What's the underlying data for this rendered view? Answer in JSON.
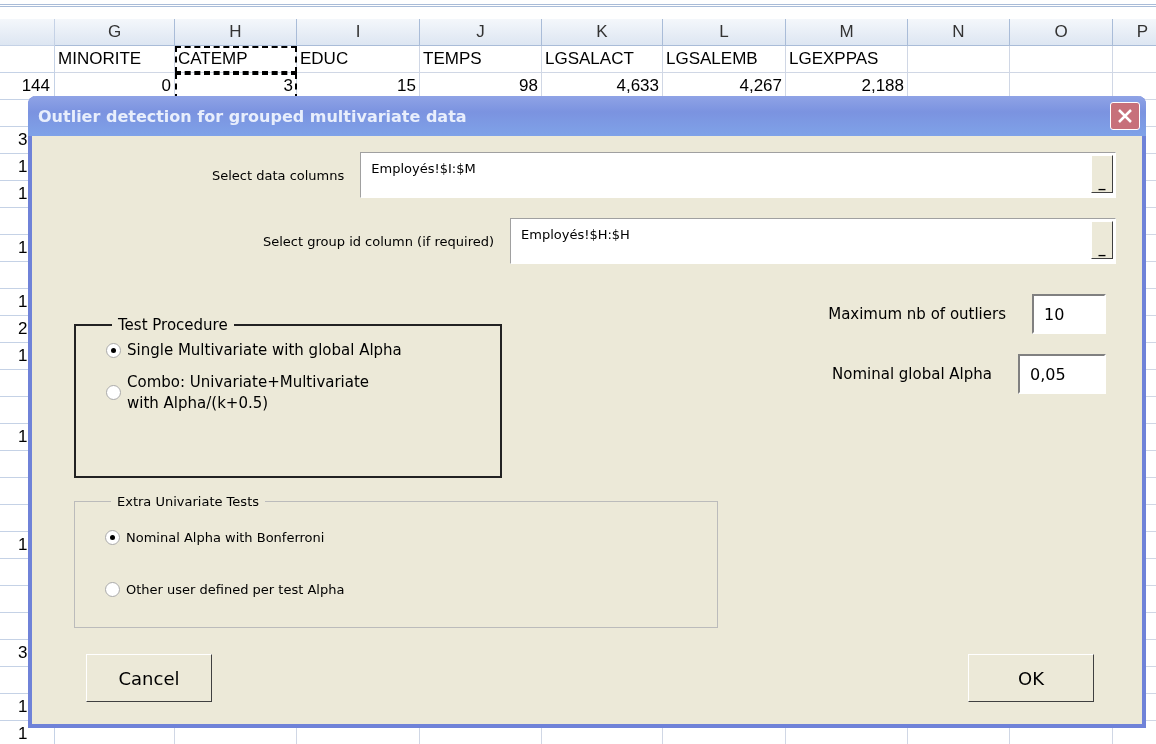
{
  "sheet": {
    "columns": [
      "G",
      "H",
      "I",
      "J",
      "K",
      "L",
      "M",
      "N",
      "O",
      "P"
    ],
    "header_row": [
      "MINORITE",
      "CATEMP",
      "EDUC",
      "TEMPS",
      "LGSALACT",
      "LGSALEMB",
      "LGEXPPAS"
    ],
    "first_row": {
      "number": "144",
      "cells": [
        "0",
        "3",
        "15",
        "98",
        "4,633",
        "4,267",
        "2,188"
      ]
    },
    "rows": [
      {
        "kind": "blank"
      },
      {
        "kind": "numbered",
        "number": "3"
      },
      {
        "kind": "numbered",
        "number": "1"
      },
      {
        "kind": "numbered",
        "number": "1"
      },
      {
        "kind": "blank"
      },
      {
        "kind": "numbered",
        "number": "1"
      },
      {
        "kind": "blank"
      },
      {
        "kind": "numbered",
        "number": "1"
      },
      {
        "kind": "numbered",
        "number": "2"
      },
      {
        "kind": "numbered",
        "number": "1"
      },
      {
        "kind": "blank"
      },
      {
        "kind": "blank"
      },
      {
        "kind": "numbered",
        "number": "1"
      },
      {
        "kind": "blank"
      },
      {
        "kind": "blank"
      },
      {
        "kind": "blank"
      },
      {
        "kind": "numbered",
        "number": "1"
      },
      {
        "kind": "blank"
      },
      {
        "kind": "blank"
      },
      {
        "kind": "blank"
      },
      {
        "kind": "numbered",
        "number": "3"
      },
      {
        "kind": "blank"
      },
      {
        "kind": "numbered",
        "number": "1"
      },
      {
        "kind": "numbered",
        "number": "1"
      }
    ]
  },
  "dialog": {
    "title": "Outlier detection for grouped multivariate data",
    "ref_fields": [
      {
        "label": "Select data columns",
        "value": "Employés!$I:$M",
        "collapse_button": "_"
      },
      {
        "label": "Select group id column (if required)",
        "value": "Employés!$H:$H",
        "collapse_button": "_"
      }
    ],
    "test_procedure": {
      "title": "Test Procedure",
      "options": [
        {
          "label": "Single Multivariate with global Alpha",
          "selected": true
        },
        {
          "label": "Combo: Univariate+Multivariate\nwith Alpha/(k+0.5)",
          "selected": false
        }
      ]
    },
    "extra_tests": {
      "title": "Extra Univariate Tests",
      "options": [
        {
          "label": "Nominal Alpha with Bonferroni",
          "selected": true
        },
        {
          "label": "Other user defined per test Alpha",
          "selected": false
        }
      ]
    },
    "settings": [
      {
        "label": "Maximum nb of outliers",
        "value": "10"
      },
      {
        "label": "Nominal global Alpha",
        "value": "0,05"
      }
    ],
    "buttons": [
      "Cancel",
      "OK"
    ]
  }
}
